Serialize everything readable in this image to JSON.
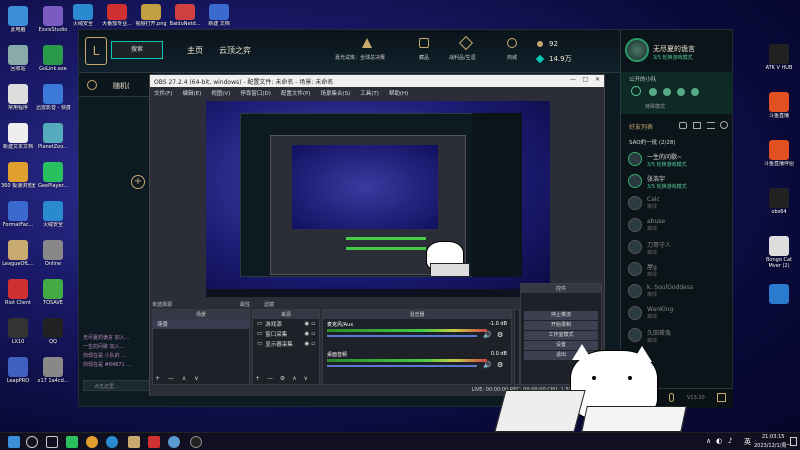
{
  "desktop_left": [
    {
      "label": "此电脑",
      "color": "#3b8fd9"
    },
    {
      "label": "EsvisStudio",
      "color": "#7a5cc0"
    },
    {
      "label": "回收站",
      "color": "#8aa"
    },
    {
      "label": "GoLink.exe",
      "color": "#2a9a4a"
    },
    {
      "label": "常用程序",
      "color": "#ddd"
    },
    {
      "label": "迅雷影音 - 快捷方式",
      "color": "#3b7ad9"
    },
    {
      "label": "新建文本文档",
      "color": "#eee"
    },
    {
      "label": "PlanetZoo...",
      "color": "#5ab"
    },
    {
      "label": "360 极速浏览器X",
      "color": "#e0a030"
    },
    {
      "label": "GeePlayer...",
      "color": "#2ac060"
    },
    {
      "label": "FormatFac...",
      "color": "#3a6ad0"
    },
    {
      "label": "火绒安全",
      "color": "#2a8ad0"
    },
    {
      "label": "LeagueOfL...",
      "color": "#c8aa6e"
    },
    {
      "label": "Online",
      "color": "#888"
    },
    {
      "label": "Riot Client",
      "color": "#d03030"
    },
    {
      "label": "TOSAVE",
      "color": "#4a4"
    },
    {
      "label": "LX10",
      "color": "#333"
    },
    {
      "label": "QQ",
      "color": "#222"
    },
    {
      "label": "LeapPRO",
      "color": "#4060c0"
    },
    {
      "label": "x17 1a4cd...",
      "color": "#888"
    }
  ],
  "desktop_top": [
    "火绒安全",
    "大番茄专业...",
    "视频打开.png",
    "BaiduNetd...",
    "新建 文档"
  ],
  "desktop_right": [
    {
      "label": "ATK V HUB",
      "color": "#222"
    },
    {
      "label": "斗鱼直播",
      "color": "#e05020"
    },
    {
      "label": "斗鱼直播伴侣",
      "color": "#e05020"
    },
    {
      "label": "obs64",
      "color": "#222"
    },
    {
      "label": "Bongo Cat Mver (2)",
      "color": "#ddd"
    },
    {
      "label": "",
      "color": "#2a7ad0"
    }
  ],
  "lol": {
    "search_placeholder": "搜索",
    "nav": [
      "主页",
      "云顶之弈"
    ],
    "icons": [
      {
        "label": "嘉光试炼：全球总决赛"
      },
      {
        "label": "藏品"
      },
      {
        "label": "战利品/生涯"
      },
      {
        "label": "商城"
      }
    ],
    "currency_be": "92",
    "currency_rp": "14.9万",
    "profile_name": "无尽夏的诡言",
    "profile_status": "3/5 轮换游戏模式",
    "left_panel_title": "随机(",
    "chat_lines": [
      "无尽夏的诡言 加入...",
      "一生的问歌 加入...",
      "你现在是 小队的 ...",
      "你现在是 #84871 ..."
    ],
    "chat_placeholder": "点击这里...",
    "party_label": "公开的小队",
    "party_mode": "特殊模式",
    "friends_header": "好友列表",
    "group_label": "SAO的一批 (2/28)",
    "friends": [
      {
        "name": "一生的问歌~",
        "status": "3/5 轮换游戏模式",
        "online": true
      },
      {
        "name": "张浩宇",
        "status": "3/5 轮换游戏模式",
        "online": true
      },
      {
        "name": "Calc",
        "status": "离线",
        "online": false
      },
      {
        "name": "abuse",
        "status": "离线",
        "online": false
      },
      {
        "name": "刀哥守人",
        "status": "离线",
        "online": false
      },
      {
        "name": "屋g",
        "status": "离线",
        "online": false
      },
      {
        "name": "k. SoulGoddess",
        "status": "离线",
        "online": false
      },
      {
        "name": "WanKing",
        "status": "离线",
        "online": false
      },
      {
        "name": "久田茶兔",
        "status": "离线",
        "online": false
      }
    ],
    "version": "V13.20"
  },
  "obs": {
    "title": "OBS 27.2.4 (64-bit, windows) - 配置文件: 未命名 - 场景: 未命名",
    "menu": [
      "文件(F)",
      "编辑(E)",
      "视图(V)",
      "停靠窗口(D)",
      "配置文件(P)",
      "场景集合(S)",
      "工具(T)",
      "帮助(H)"
    ],
    "scenes_header": "场景",
    "scene_item": "场景",
    "sources_header": "来源",
    "sources": [
      "游戏源",
      "窗口采集",
      "显示器采集"
    ],
    "status_left": "未选择源",
    "props_btn": "属性",
    "filters_btn": "滤镜",
    "mixer_header": "混音器",
    "mixer": [
      {
        "name": "麦克风/Aux",
        "db": "-1.0 dB"
      },
      {
        "name": "桌面音频",
        "db": "0.0 dB"
      }
    ],
    "transitions_header": "转场特效",
    "controls_header": "控件",
    "controls": [
      "停止推流",
      "开始录制",
      "工作室模式",
      "设置",
      "退出"
    ],
    "statusbar": "LIVE: 00:00:00   REC: 00:00:00   CPU: 1.5%, 30.00 fps"
  },
  "taskbar": {
    "time": "21:03:15",
    "date": "2023/12/1/周一",
    "ime": "英"
  }
}
